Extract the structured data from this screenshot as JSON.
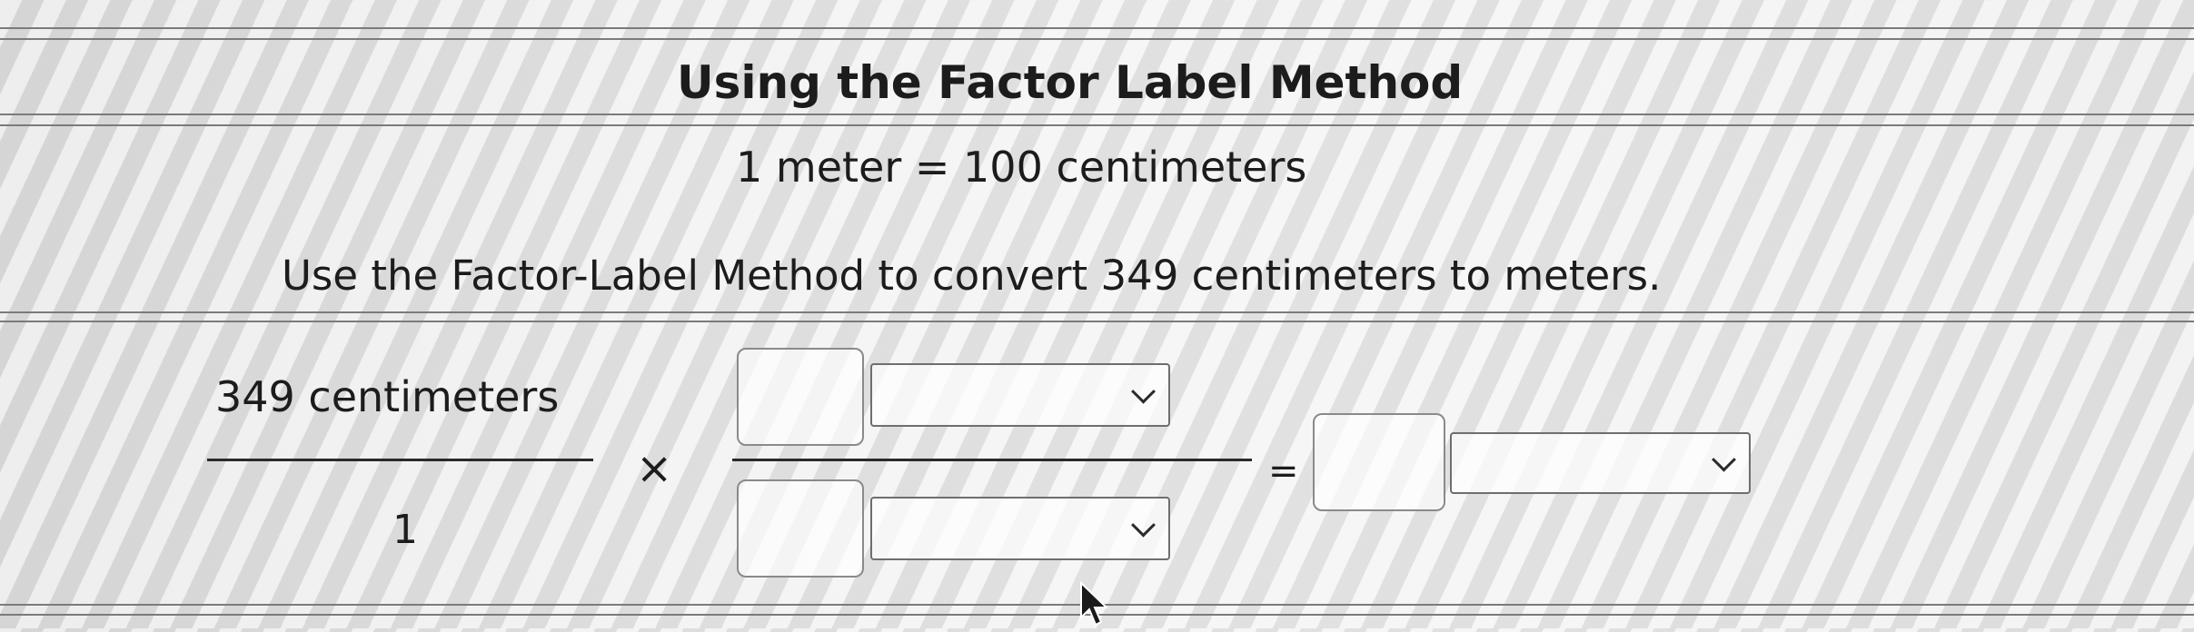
{
  "problem": {
    "title": "Using the Factor Label Method",
    "equivalence": "1 meter = 100 centimeters",
    "question": "Use the Factor-Label Method to convert 349 centimeters to meters."
  },
  "given_fraction": {
    "numerator": "349 centimeters",
    "denominator": "1"
  },
  "operators": {
    "times": "×",
    "equals": "="
  },
  "conversion_factor": {
    "numerator_value": "",
    "numerator_unit": "",
    "denominator_value": "",
    "denominator_unit": ""
  },
  "answer": {
    "value": "",
    "unit": ""
  },
  "icons": {
    "dropdown": "chevron-down-icon",
    "cursor": "mouse-pointer-icon"
  }
}
